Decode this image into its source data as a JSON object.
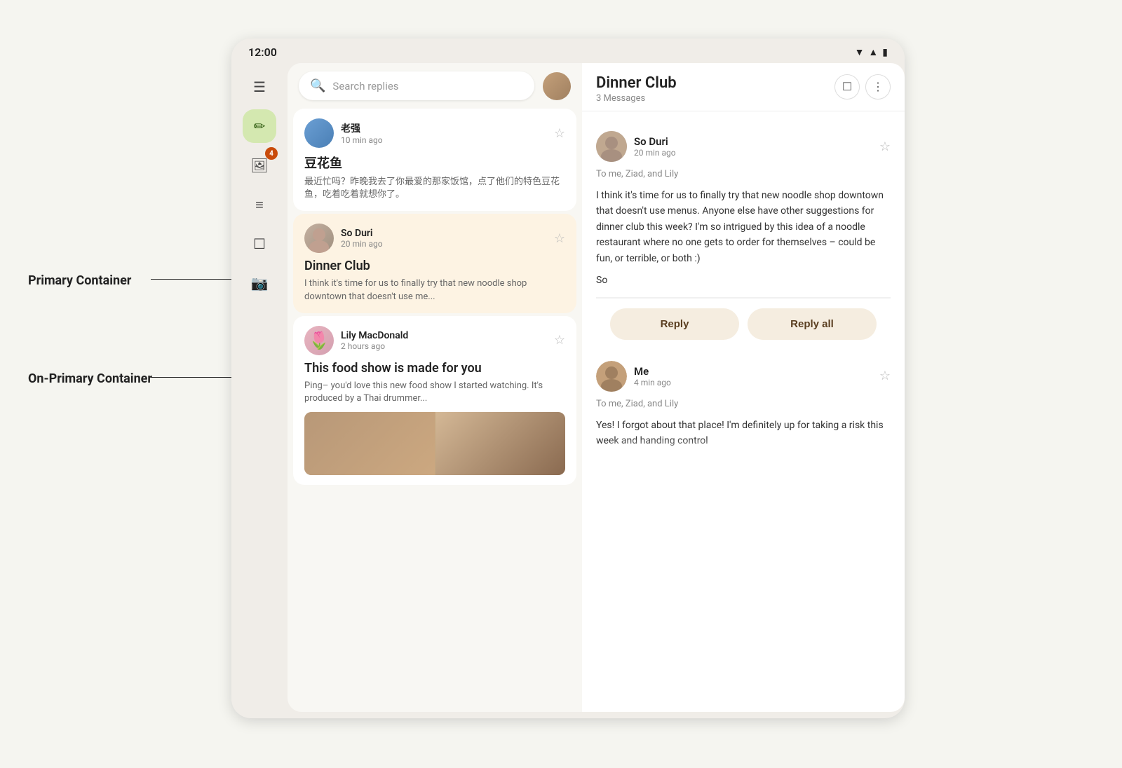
{
  "statusBar": {
    "time": "12:00",
    "icons": [
      "wifi",
      "signal",
      "battery"
    ]
  },
  "labels": {
    "primaryContainer": "Primary Container",
    "onPrimaryContainer": "On-Primary Container"
  },
  "sidebar": {
    "icons": [
      {
        "name": "menu",
        "glyph": "☰",
        "active": false
      },
      {
        "name": "compose",
        "glyph": "✏",
        "active": true
      },
      {
        "name": "notifications",
        "glyph": "🖼",
        "active": false,
        "badge": "4"
      },
      {
        "name": "list",
        "glyph": "☰",
        "active": false
      },
      {
        "name": "chat",
        "glyph": "☐",
        "active": false
      },
      {
        "name": "video",
        "glyph": "🎬",
        "active": false
      }
    ]
  },
  "emailList": {
    "searchPlaceholder": "Search replies",
    "emails": [
      {
        "sender": "老强",
        "time": "10 min ago",
        "subject": "豆花鱼",
        "preview": "最近忙吗？昨晚我去了你最爱的那家饭馆，点了他们的特色豆花鱼，吃着吃着就想你了。",
        "avatarClass": "av-laomao",
        "selected": false,
        "starred": false
      },
      {
        "sender": "So Duri",
        "time": "20 min ago",
        "subject": "Dinner Club",
        "preview": "I think it's time for us to finally try that new noodle shop downtown that doesn't use me...",
        "avatarClass": "av-soduri",
        "selected": true,
        "starred": false
      },
      {
        "sender": "Lily MacDonald",
        "time": "2 hours ago",
        "subject": "This food show is made for you",
        "preview": "Ping– you'd love this new food show I started watching. It's produced by a Thai drummer...",
        "avatarClass": "av-lily",
        "selected": false,
        "starred": false,
        "hasImage": true
      }
    ]
  },
  "emailDetail": {
    "title": "Dinner Club",
    "messageCount": "3 Messages",
    "messages": [
      {
        "sender": "So Duri",
        "time": "20 min ago",
        "to": "To me, Ziad, and Lily",
        "body": "I think it's time for us to finally try that new noodle shop downtown that doesn't use menus. Anyone else have other suggestions for dinner club this week? I'm so intrigued by this idea of a noodle restaurant where no one gets to order for themselves – could be fun, or terrible, or both :)",
        "signature": "So",
        "avatarClass": "av-soduri"
      },
      {
        "sender": "Me",
        "time": "4 min ago",
        "to": "To me, Ziad, and Lily",
        "body": "Yes! I forgot about that place! I'm definitely up for taking a risk this week and handing control",
        "signature": "",
        "avatarClass": "av-me",
        "truncated": true
      }
    ],
    "replyLabel": "Reply",
    "replyAllLabel": "Reply all"
  }
}
